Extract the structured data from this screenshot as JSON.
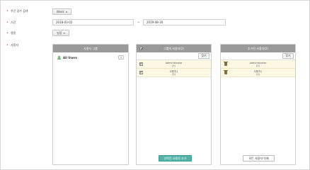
{
  "form": {
    "period_unit": {
      "label": "주간 검수 검색",
      "value": "Week"
    },
    "date_range": {
      "label": "기간",
      "start": "2018-03-02",
      "separator": "~",
      "end": "2019-08-30"
    },
    "usage": {
      "label": "용용",
      "value": "범용"
    },
    "users": {
      "label": "사용자"
    }
  },
  "panels": {
    "user_group": {
      "title": "사용자 그룹",
      "tree": [
        {
          "label": "All Users",
          "count": "0"
        }
      ]
    },
    "group_users": {
      "title": "그룹의 사용자(2)",
      "search_label": "찾기",
      "rows": [
        {
          "line1": "Administrator",
          "line2": "(1)"
        },
        {
          "line1": "사용자1",
          "line2": "(2)"
        }
      ],
      "footer_button": "선택된 사용자 추가"
    },
    "added_users": {
      "title": "추가된 사용자(2)",
      "search_label": "찾기",
      "rows": [
        {
          "line1": "Administrator",
          "line2": "(1)"
        },
        {
          "line1": "사용자1",
          "line2": "(2)"
        }
      ],
      "footer_button": "모든 사용자 삭제"
    }
  },
  "colors": {
    "required_bullet": "#d9534f",
    "panel_header": "#9a9a9a",
    "selected_row": "#fcf8e3",
    "primary_button": "#4fb3a9"
  }
}
